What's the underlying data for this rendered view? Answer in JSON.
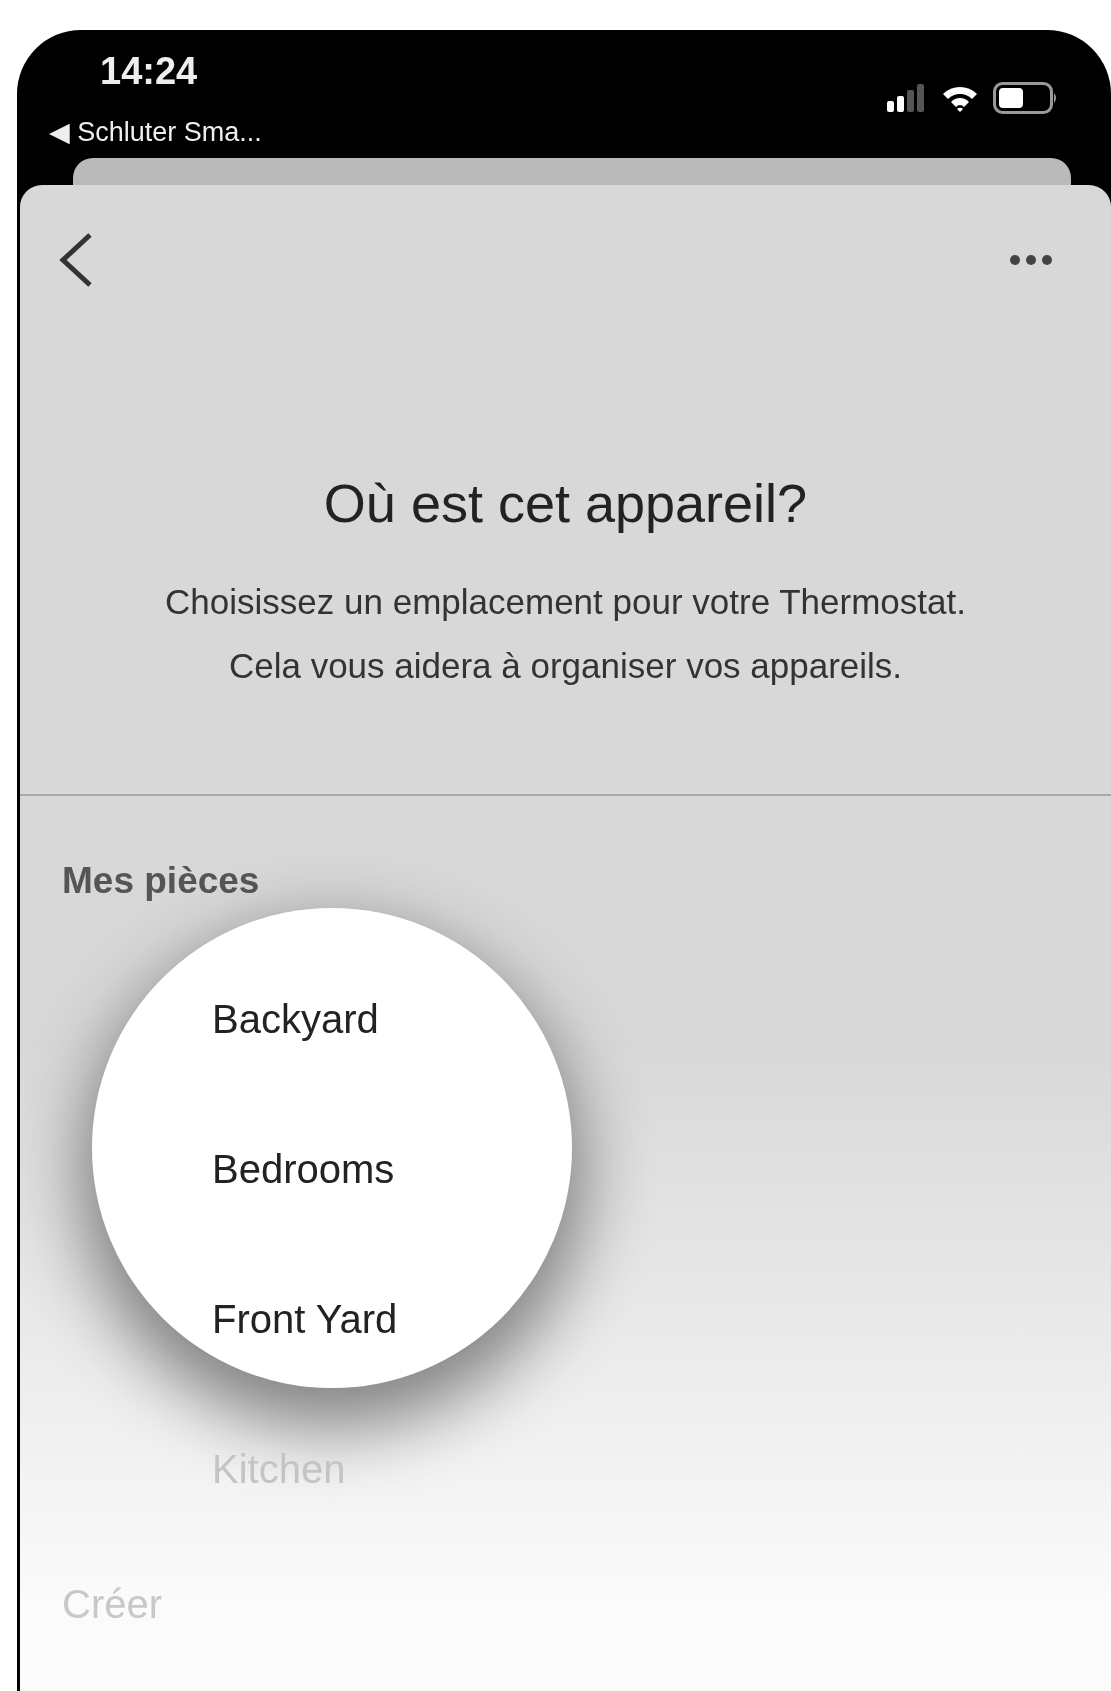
{
  "status_bar": {
    "time": "14:24",
    "back_app": "◀ Schluter Sma..."
  },
  "header": {
    "title": "Où est cet appareil?",
    "description": "Choisissez un emplacement pour votre Thermostat. Cela vous aidera à organiser vos appareils."
  },
  "rooms_section": {
    "heading": "Mes pièces",
    "rooms": [
      {
        "name": "Backyard",
        "highlighted": true
      },
      {
        "name": "Bedrooms",
        "highlighted": true
      },
      {
        "name": "Front Yard",
        "highlighted": true
      },
      {
        "name": "Kitchen",
        "highlighted": false
      }
    ],
    "create_label": "Créer"
  }
}
